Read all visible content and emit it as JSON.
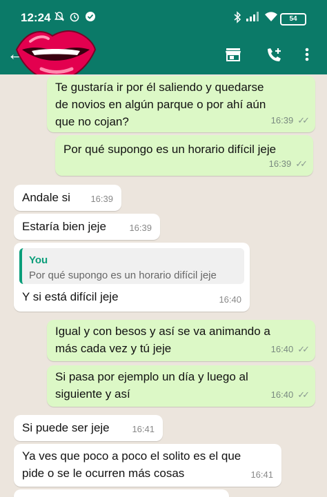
{
  "status_bar": {
    "time": "12:24",
    "battery": "54"
  },
  "header": {
    "back": "←"
  },
  "messages": [
    {
      "dir": "out",
      "text": "Te gustaría ir por él saliendo y quedarse\nde novios en algún parque o por ahí aún\nque no cojan?",
      "time": "16:39",
      "status": "read"
    },
    {
      "dir": "out",
      "text": "Por qué supongo es un horario difícil jeje",
      "time": "16:39",
      "status": "read"
    },
    {
      "dir": "in",
      "text": "Andale si",
      "time": "16:39"
    },
    {
      "dir": "in",
      "text": "Estaría bien jeje",
      "time": "16:39"
    },
    {
      "dir": "in",
      "quote_author": "You",
      "quote_text": "Por qué supongo es un horario difícil jeje",
      "text": "Y si está difícil jeje",
      "time": "16:40"
    },
    {
      "dir": "out",
      "text": "Igual y con besos y así se va animando a\nmás cada vez y tú jeje",
      "time": "16:40",
      "status": "read"
    },
    {
      "dir": "out",
      "text": "Si pasa por ejemplo un día y luego al\nsiguiente y así",
      "time": "16:40",
      "status": "read"
    },
    {
      "dir": "in",
      "text": "Si puede ser jeje",
      "time": "16:41"
    },
    {
      "dir": "in",
      "text": "Ya ves que poco a poco el solito es el que\npide o se le ocurren más cosas",
      "time": "16:41"
    }
  ]
}
